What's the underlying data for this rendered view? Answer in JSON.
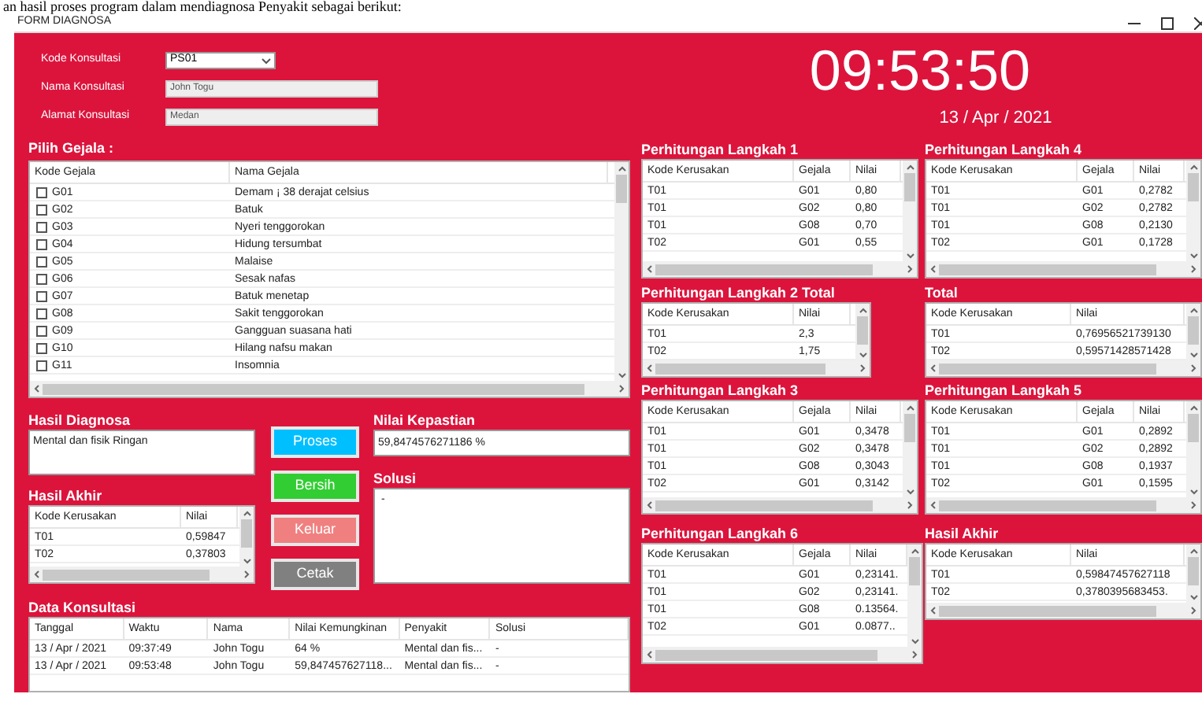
{
  "document_text": "an hasil proses program dalam mendiagnosa Penyakit sebagai berikut:",
  "window": {
    "title": "FORM DIAGNOSA"
  },
  "fields": [
    {
      "label": "Kode Konsultasi",
      "value": "PS01",
      "kind": "combo"
    },
    {
      "label": "Nama Konsultasi",
      "value": "John Togu",
      "kind": "readonly"
    },
    {
      "label": "Alamat Konsultasi",
      "value": "Medan",
      "kind": "readonly"
    }
  ],
  "clock": {
    "time": "09:53:50",
    "date": "13 / Apr / 2021"
  },
  "symptoms": {
    "title": "Pilih Gejala  :",
    "columns": [
      "Kode Gejala",
      "Nama Gejala"
    ],
    "rows": [
      {
        "code": "G01",
        "name": "Demam ¡ 38 derajat celsius",
        "checked": false
      },
      {
        "code": "G02",
        "name": "Batuk",
        "checked": false
      },
      {
        "code": "G03",
        "name": "Nyeri tenggorokan",
        "checked": false
      },
      {
        "code": "G04",
        "name": "Hidung tersumbat",
        "checked": false
      },
      {
        "code": "G05",
        "name": "Malaise",
        "checked": false
      },
      {
        "code": "G06",
        "name": "Sesak nafas",
        "checked": false
      },
      {
        "code": "G07",
        "name": "Batuk menetap",
        "checked": false
      },
      {
        "code": "G08",
        "name": "Sakit tenggorokan",
        "checked": false
      },
      {
        "code": "G09",
        "name": "Gangguan suasana hati",
        "checked": false
      },
      {
        "code": "G10",
        "name": "Hilang nafsu makan",
        "checked": false
      },
      {
        "code": "G11",
        "name": "Insomnia",
        "checked": false
      }
    ]
  },
  "diagnosis": {
    "title": "Hasil Diagnosa",
    "value": "Mental dan fisik Ringan"
  },
  "buttons": [
    {
      "label": "Proses",
      "color": "#00bfff"
    },
    {
      "label": "Bersih",
      "color": "#32cd32"
    },
    {
      "label": "Keluar",
      "color": "#f08080"
    },
    {
      "label": "Cetak",
      "color": "#808080"
    }
  ],
  "certainty": {
    "title": "Nilai Kepastian",
    "value": "59,8474576271186 %"
  },
  "solution": {
    "title": "Solusi",
    "value": "-"
  },
  "final_left": {
    "title": "Hasil Akhir",
    "columns": [
      "Kode Kerusakan",
      "Nilai"
    ],
    "rows": [
      [
        "T01",
        "0,59847"
      ],
      [
        "T02",
        "0,37803"
      ]
    ]
  },
  "consultations": {
    "title": "Data Konsultasi",
    "columns": [
      "Tanggal",
      "Waktu",
      "Nama",
      "Nilai Kemungkinan",
      "Penyakit",
      "Solusi"
    ],
    "rows": [
      [
        "13 / Apr / 2021",
        "09:37:49",
        "John Togu",
        "64 %",
        "Mental dan fis...",
        "-"
      ],
      [
        "13 / Apr / 2021",
        "09:53:48",
        "John Togu",
        "59,847457627118...",
        "Mental dan fis...",
        "-"
      ]
    ]
  },
  "step_1": {
    "title": "Perhitungan Langkah 1",
    "columns": [
      "Kode Kerusakan",
      "Gejala",
      "Nilai"
    ],
    "rows": [
      [
        "T01",
        "G01",
        "0,80"
      ],
      [
        "T01",
        "G02",
        "0,80"
      ],
      [
        "T01",
        "G08",
        "0,70"
      ],
      [
        "T02",
        "G01",
        "0,55"
      ]
    ]
  },
  "step_2_total": {
    "title": "Perhitungan Langkah 2 Total",
    "columns": [
      "Kode Kerusakan",
      "Nilai"
    ],
    "rows": [
      [
        "T01",
        "2,3"
      ],
      [
        "T02",
        "1,75"
      ]
    ]
  },
  "step_3": {
    "title": "Perhitungan Langkah 3",
    "columns": [
      "Kode Kerusakan",
      "Gejala",
      "Nilai"
    ],
    "rows": [
      [
        "T01",
        "G01",
        "0,3478"
      ],
      [
        "T01",
        "G02",
        "0,3478"
      ],
      [
        "T01",
        "G08",
        "0,3043"
      ],
      [
        "T02",
        "G01",
        "0,3142"
      ]
    ]
  },
  "step_6": {
    "title": "Perhitungan Langkah 6",
    "columns": [
      "Kode Kerusakan",
      "Gejala",
      "Nilai"
    ],
    "rows": [
      [
        "T01",
        "G01",
        "0,23141."
      ],
      [
        "T01",
        "G02",
        "0,23141."
      ],
      [
        "T01",
        "G08",
        "0.13564."
      ],
      [
        "T02",
        "G01",
        "0.0877.."
      ]
    ]
  },
  "step_4": {
    "title": "Perhitungan Langkah 4",
    "columns": [
      "Kode Kerusakan",
      "Gejala",
      "Nilai"
    ],
    "rows": [
      [
        "T01",
        "G01",
        "0,2782"
      ],
      [
        "T01",
        "G02",
        "0,2782"
      ],
      [
        "T01",
        "G08",
        "0,2130"
      ],
      [
        "T02",
        "G01",
        "0,1728"
      ]
    ]
  },
  "total": {
    "title": "Total",
    "columns": [
      "Kode Kerusakan",
      "Nilai"
    ],
    "rows": [
      [
        "T01",
        "0,76956521739130"
      ],
      [
        "T02",
        "0,59571428571428"
      ]
    ]
  },
  "step_5": {
    "title": "Perhitungan Langkah 5",
    "columns": [
      "Kode Kerusakan",
      "Gejala",
      "Nilai"
    ],
    "rows": [
      [
        "T01",
        "G01",
        "0,2892"
      ],
      [
        "T01",
        "G02",
        "0,2892"
      ],
      [
        "T01",
        "G08",
        "0,1937"
      ],
      [
        "T02",
        "G01",
        "0,1595"
      ]
    ]
  },
  "final_right": {
    "title": "Hasil Akhir",
    "columns": [
      "Kode Kerusakan",
      "Nilai"
    ],
    "rows": [
      [
        "T01",
        "0,59847457627118"
      ],
      [
        "T02",
        "0,3780395683453."
      ]
    ]
  }
}
